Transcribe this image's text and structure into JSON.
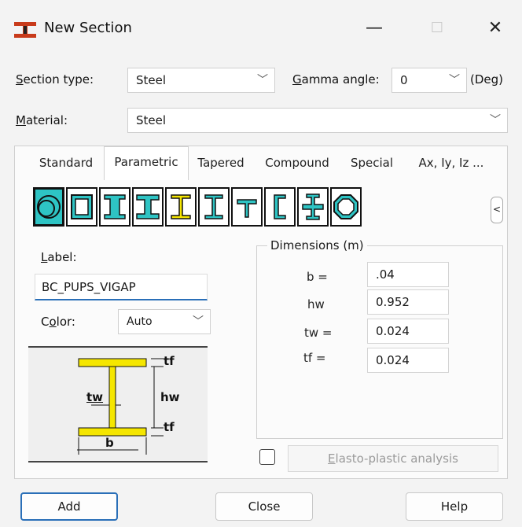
{
  "window": {
    "title": "New Section",
    "minimize": "—",
    "maximize": "☐",
    "close": "✕"
  },
  "form": {
    "section_type_label": "Section type:",
    "section_type_value": "Steel",
    "gamma_label": "Gamma angle:",
    "gamma_value": "0",
    "gamma_unit": "(Deg)",
    "material_label": "Material:",
    "material_value": "Steel"
  },
  "tabs": [
    "Standard",
    "Parametric",
    "Tapered",
    "Compound",
    "Special",
    "Ax, Iy, Iz ..."
  ],
  "active_tab": "Parametric",
  "section_icons": [
    "tube-icon",
    "box-icon",
    "i-beam-icon",
    "wide-i-icon",
    "i-section-selected-icon",
    "i-section-icon",
    "t-section-icon",
    "channel-icon",
    "cross-section-icon",
    "octagon-icon"
  ],
  "scroll_left": "<",
  "label_field": {
    "label": "Label:",
    "value": "BC_PUPS_VIGAP"
  },
  "color_field": {
    "label": "Color:",
    "value": "Auto"
  },
  "diagram": {
    "tf_top": "tf",
    "hw": "hw",
    "tw": "tw",
    "tf_bottom": "tf",
    "b": "b"
  },
  "dimensions": {
    "title": "Dimensions (m)",
    "rows": [
      {
        "label": "b  =",
        "value": ".04"
      },
      {
        "label": "hw",
        "value": "0.952"
      },
      {
        "label": "tw  =",
        "value": "0.024"
      },
      {
        "label": "tf  =",
        "value": "0.024"
      }
    ]
  },
  "elasto_plastic": "Elasto-plastic analysis",
  "buttons": {
    "add": "Add",
    "close": "Close",
    "help": "Help"
  },
  "colors": {
    "accent": "#2a6fb8",
    "icon_fill": "#2ec4c4",
    "selected_icon_fill": "#f5e600"
  }
}
